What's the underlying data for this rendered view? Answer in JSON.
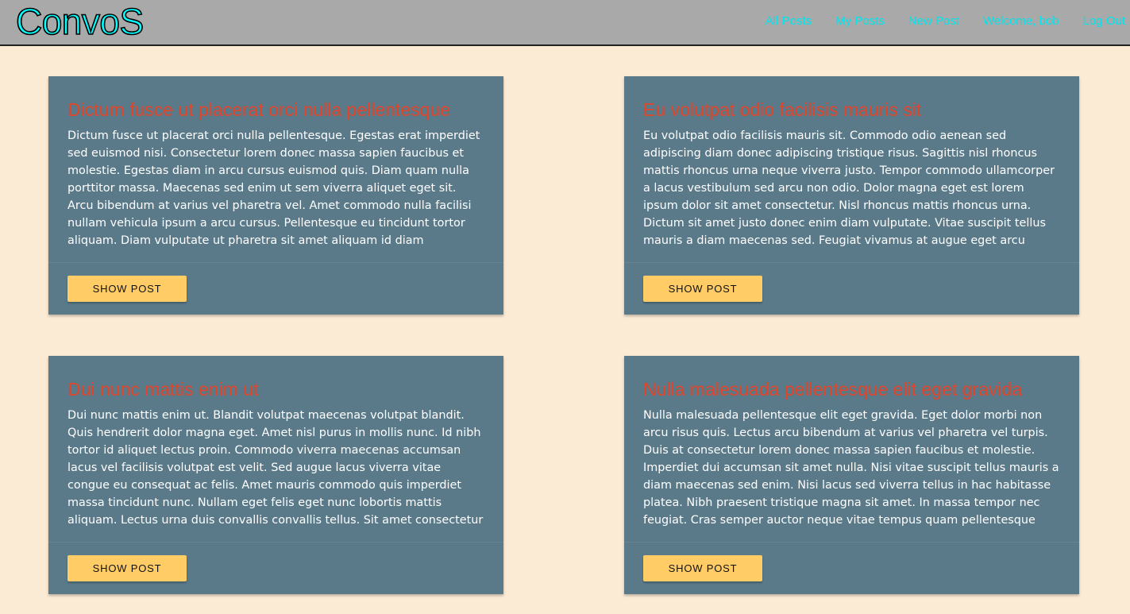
{
  "brand": {
    "logo": "ConvoS"
  },
  "nav": {
    "all_posts": "All Posts",
    "my_posts": "My Posts",
    "new_post": "New Post",
    "welcome": "Welcome, bob",
    "log_out": "Log Out"
  },
  "colors": {
    "page_bg": "#fbead4",
    "navbar_bg": "#a9a9a9",
    "logo": "#00ffff",
    "nav_link": "#00e5ee",
    "card_bg": "#5a7a8a",
    "card_title": "#e0452a",
    "button_bg": "#ffcc66"
  },
  "posts": [
    {
      "title": "Dictum fusce ut placerat orci nulla pellentesque",
      "body": "Dictum fusce ut placerat orci nulla pellentesque. Egestas erat imperdiet sed euismod nisi. Consectetur lorem donec massa sapien faucibus et molestie. Egestas diam in arcu cursus euismod quis. Diam quam nulla porttitor massa. Maecenas sed enim ut sem viverra aliquet eget sit. Arcu bibendum at varius vel pharetra vel. Amet commodo nulla facilisi nullam vehicula ipsum a arcu cursus. Pellentesque eu tincidunt tortor aliquam. Diam vulputate ut pharetra sit amet aliquam id diam maecenas.",
      "button": "SHOW POST"
    },
    {
      "title": "Eu volutpat odio facilisis mauris sit",
      "body": "Eu volutpat odio facilisis mauris sit. Commodo odio aenean sed adipiscing diam donec adipiscing tristique risus. Sagittis nisl rhoncus mattis rhoncus urna neque viverra justo. Tempor commodo ullamcorper a lacus vestibulum sed arcu non odio. Dolor magna eget est lorem ipsum dolor sit amet consectetur. Nisl rhoncus mattis rhoncus urna. Dictum sit amet justo donec enim diam vulputate. Vitae suscipit tellus mauris a diam maecenas sed. Feugiat vivamus at augue eget arcu dictum varius duis at. Magnis dis partui",
      "button": "SHOW POST"
    },
    {
      "title": "Dui nunc mattis enim ut",
      "body": "Dui nunc mattis enim ut. Blandit volutpat maecenas volutpat blandit. Quis hendrerit dolor magna eget. Amet nisl purus in mollis nunc. Id nibh tortor id aliquet lectus proin. Commodo viverra maecenas accumsan lacus vel facilisis volutpat est velit. Sed augue lacus viverra vitae congue eu consequat ac felis. Amet mauris commodo quis imperdiet massa tincidunt nunc. Nullam eget felis eget nunc lobortis mattis aliquam. Lectus urna duis convallis convallis tellus. Sit amet consectetur adipiscing elit",
      "button": "SHOW POST"
    },
    {
      "title": "Nulla malesuada pellentesque elit eget gravida",
      "body": "Nulla malesuada pellentesque elit eget gravida. Eget dolor morbi non arcu risus quis. Lectus arcu bibendum at varius vel pharetra vel turpis. Duis at consectetur lorem donec massa sapien faucibus et molestie. Imperdiet dui accumsan sit amet nulla. Nisi vitae suscipit tellus mauris a diam maecenas sed enim. Nisi lacus sed viverra tellus in hac habitasse platea. Nibh praesent tristique magna sit amet. In massa tempor nec feugiat. Cras semper auctor neque vitae tempus quam pellentesque nec. Parturi",
      "button": "SHOW POST"
    }
  ]
}
